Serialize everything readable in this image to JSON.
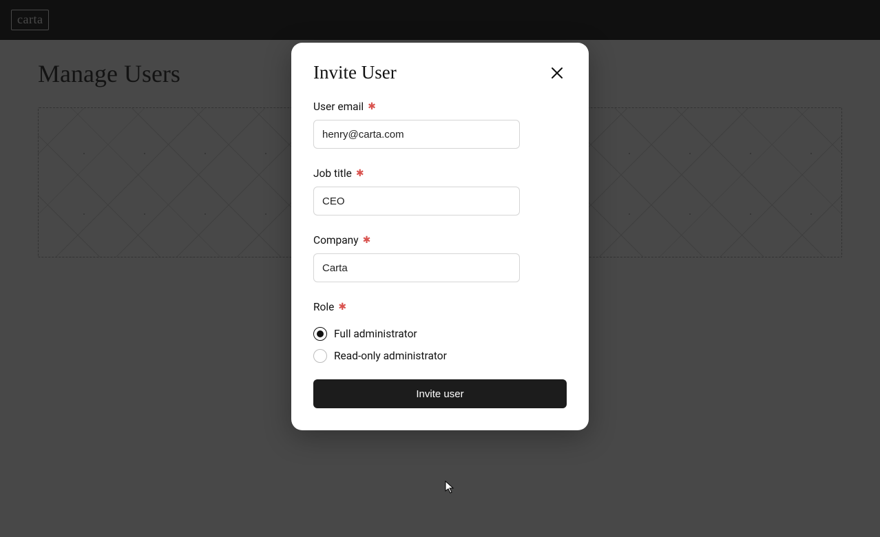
{
  "brand": "carta",
  "page": {
    "title": "Manage Users"
  },
  "modal": {
    "title": "Invite User",
    "fields": {
      "email": {
        "label": "User email",
        "value": "henry@carta.com",
        "required": true
      },
      "job_title": {
        "label": "Job title",
        "value": "CEO",
        "required": true
      },
      "company": {
        "label": "Company",
        "value": "Carta",
        "required": true
      },
      "role": {
        "label": "Role",
        "required": true,
        "selected": "full",
        "options": {
          "full": "Full administrator",
          "readonly": "Read-only administrator"
        }
      }
    },
    "submit_label": "Invite user",
    "required_marker": "✱"
  }
}
